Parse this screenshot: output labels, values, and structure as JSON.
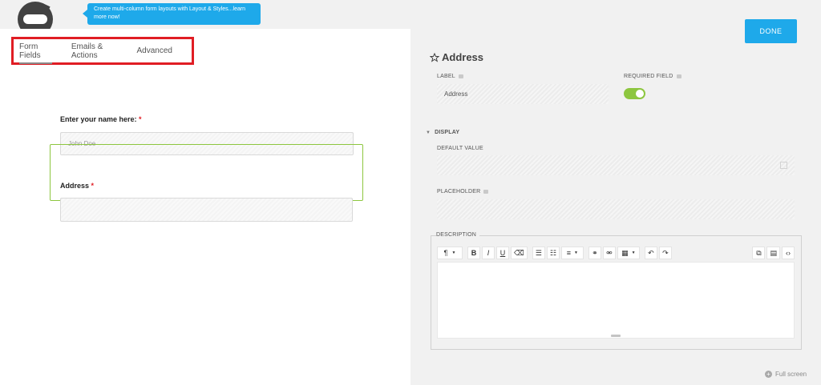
{
  "tooltip": {
    "text": "Create multi-column form layouts with Layout & Styles...learn more now!"
  },
  "tabs": [
    {
      "label": "Form Fields",
      "active": true
    },
    {
      "label": "Emails & Actions",
      "active": false
    },
    {
      "label": "Advanced",
      "active": false
    }
  ],
  "form": {
    "name_label": "Enter your name here:",
    "name_placeholder": "John Doe",
    "address_label": "Address",
    "required_mark": "*"
  },
  "done_label": "DONE",
  "panel": {
    "title": "Address",
    "label_heading": "LABEL",
    "label_value": "Address",
    "required_heading": "REQUIRED FIELD",
    "required_on": true,
    "display_heading": "DISPLAY",
    "default_value_heading": "DEFAULT VALUE",
    "placeholder_heading": "PLACEHOLDER",
    "description_heading": "DESCRIPTION"
  },
  "toolbar": {
    "paragraph": "¶",
    "bold": "B",
    "italic": "I",
    "underline": "U"
  },
  "fullscreen_label": "Full screen",
  "colors": {
    "accent": "#1ea9ea",
    "toggle": "#8dc63f",
    "highlight": "#e01d24"
  }
}
